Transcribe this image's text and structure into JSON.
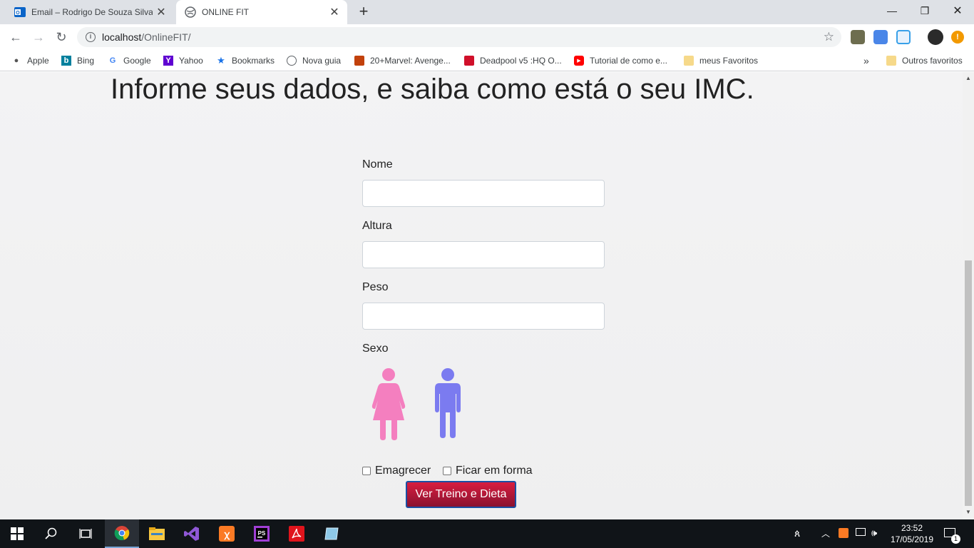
{
  "browser": {
    "tabs": [
      {
        "title": "Email – Rodrigo De Souza Silva –",
        "active": false
      },
      {
        "title": "ONLINE FIT",
        "active": true
      }
    ],
    "url_host": "localhost",
    "url_path": "/OnlineFIT/",
    "bookmarks": [
      {
        "label": "Apple",
        "icon": "apple-icon"
      },
      {
        "label": "Bing",
        "icon": "bing-icon"
      },
      {
        "label": "Google",
        "icon": "google-icon"
      },
      {
        "label": "Yahoo",
        "icon": "yahoo-icon"
      },
      {
        "label": "Bookmarks",
        "icon": "star-icon"
      },
      {
        "label": "Nova guia",
        "icon": "globe-icon"
      },
      {
        "label": "20+Marvel: Avenge...",
        "icon": "marvel-icon"
      },
      {
        "label": "Deadpool v5 :HQ O...",
        "icon": "deadpool-icon"
      },
      {
        "label": "Tutorial de como e...",
        "icon": "youtube-icon"
      },
      {
        "label": "meus Favoritos",
        "icon": "folder-icon"
      }
    ],
    "overflow_label": "»",
    "other_favorites": "Outros favoritos"
  },
  "page": {
    "heading": "Informe seus dados, e saiba como está o seu IMC.",
    "fields": {
      "name_label": "Nome",
      "height_label": "Altura",
      "weight_label": "Peso",
      "sex_label": "Sexo"
    },
    "sex_options": [
      {
        "icon": "female-icon",
        "color": "#f47fbf"
      },
      {
        "icon": "male-icon",
        "color": "#7b7bf0"
      }
    ],
    "checkboxes": [
      {
        "label": "Emagrecer",
        "checked": false
      },
      {
        "label": "Ficar em forma",
        "checked": false
      }
    ],
    "submit_label": "Ver Treino e Dieta"
  },
  "taskbar": {
    "time": "23:52",
    "date": "17/05/2019",
    "notification_count": "1"
  },
  "colors": {
    "accent_button": "#c41a3c",
    "page_background": "#f1f1f2"
  }
}
